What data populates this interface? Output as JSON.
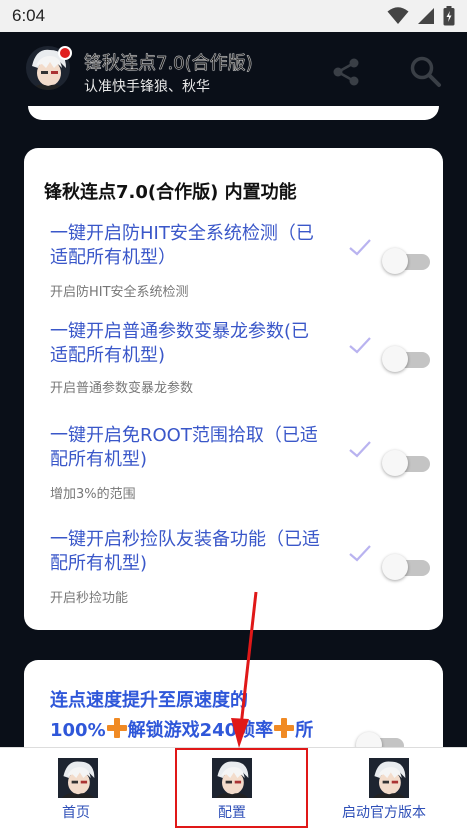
{
  "status_bar": {
    "time": "6:04"
  },
  "header": {
    "title": "锋秋连点7.0(合作版)",
    "subtitle": "认准快手锋狼、秋华",
    "icons": {
      "share": "share-icon",
      "search": "search-icon"
    }
  },
  "main_card": {
    "title": "锋秋连点7.0(合作版) 内置功能",
    "features": [
      {
        "label": "一键开启防HIT安全系统检测（已适配所有机型）",
        "sub": "开启防HIT安全系统检测",
        "enabled": false
      },
      {
        "label": "一键开启普通参数变暴龙参数(已适配所有机型)",
        "sub": "开启普通参数变暴龙参数",
        "enabled": false
      },
      {
        "label": "一键开启免ROOT范围拾取（已适配所有机型)",
        "sub": "增加3%的范围",
        "enabled": false
      },
      {
        "label": "一键开启秒捡队友装备功能（已适配所有机型)",
        "sub": "开启秒捡功能",
        "enabled": false
      }
    ]
  },
  "promo_card": {
    "line1": "连点速度提升至原速度的",
    "line2_a": "100%",
    "line2_b": "解锁游戏240帧率",
    "line2_c": "所"
  },
  "bottom_nav": {
    "items": [
      {
        "label": "首页"
      },
      {
        "label": "配置"
      },
      {
        "label": "启动官方版本"
      }
    ]
  },
  "colors": {
    "accent_blue": "#3a57c9",
    "promo_blue": "#2f57d9",
    "annotation_red": "#e01818",
    "check_purple": "#b9b3f0",
    "plus_orange": "#f08a24"
  }
}
